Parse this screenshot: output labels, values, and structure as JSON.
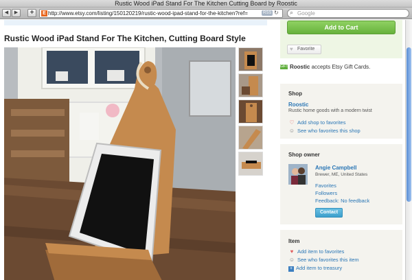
{
  "window": {
    "title": "Rustic Wood iPad Stand For The Kitchen Cutting Board by Roostic"
  },
  "toolbar": {
    "back_icon": "arrow-left-icon",
    "forward_icon": "arrow-right-icon",
    "add_label": "+",
    "url": "http://www.etsy.com/listing/150120219/rustic-wood-ipad-stand-for-the-kitchen?ref=",
    "rss_label": "RSS",
    "search_placeholder": "Google"
  },
  "listing": {
    "title": "Rustic Wood iPad Stand For The Kitchen, Cutting Board Style"
  },
  "sidebar": {
    "add_to_cart_label": "Add to Cart",
    "favorite_label": "Favorite",
    "gift_shop_name": "Roostic",
    "gift_text": " accepts Etsy Gift Cards.",
    "gift_icon_label": "GIFT",
    "shop": {
      "heading": "Shop",
      "name": "Roostic",
      "tagline": "Rustic home goods with a modern twist",
      "add_to_favorites": "Add shop to favorites",
      "see_who_favorites": "See who favorites this shop"
    },
    "owner": {
      "heading": "Shop owner",
      "name": "Angie Campbell",
      "location": "Brewer, ME, United States",
      "favorites_link": "Favorites",
      "followers_link": "Followers",
      "feedback_link": "Feedback: No feedback",
      "contact_label": "Contact"
    },
    "item": {
      "heading": "Item",
      "add_to_favorites": "Add item to favorites",
      "see_who_favorites": "See who favorites this item",
      "add_to_treasury": "Add item to treasury"
    }
  },
  "colors": {
    "cart_green": "#67b23c",
    "link_blue": "#2a76b5",
    "contact_blue": "#3c9fcc",
    "panel_bg": "#f4f3ee"
  }
}
